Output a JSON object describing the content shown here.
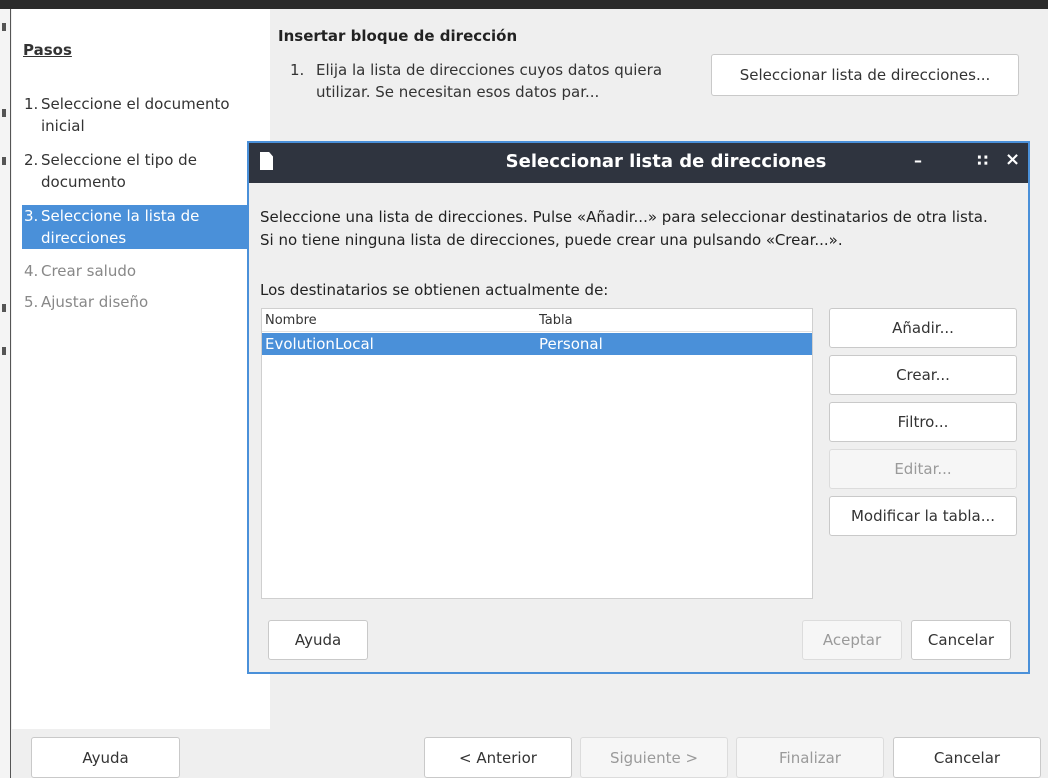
{
  "wizard": {
    "steps_title": "Pasos",
    "steps": [
      {
        "num": "1.",
        "label": "Seleccione el documento inicial"
      },
      {
        "num": "2.",
        "label": "Seleccione el tipo de documento"
      },
      {
        "num": "3.",
        "label": "Seleccione la lista de direcciones"
      },
      {
        "num": "4.",
        "label": "Crear saludo"
      },
      {
        "num": "5.",
        "label": "Ajustar diseño"
      }
    ],
    "heading": "Insertar bloque de dirección",
    "instruction_num": "1.",
    "instruction": "Elija la lista de direcciones cuyos datos quiera utilizar. Se necesitan esos datos par...",
    "select_list_button": "Seleccionar lista de direcciones...",
    "footer": {
      "help": "Ayuda",
      "back": "< Anterior",
      "next": "Siguiente >",
      "finish": "Finalizar",
      "cancel": "Cancelar"
    }
  },
  "dialog": {
    "title": "Seleccionar lista de direcciones",
    "window_buttons": {
      "minimize": "–",
      "maximize": "∷",
      "close": "×"
    },
    "description": "Seleccione una lista de direcciones. Pulse «Añadir...» para seleccionar destinatarios de otra lista. Si no tiene ninguna lista de direcciones, puede crear una pulsando «Crear...».",
    "list_label": "Los destinatarios se obtienen actualmente de:",
    "columns": [
      "Nombre",
      "Tabla"
    ],
    "rows": [
      {
        "name": "EvolutionLocal",
        "table": "Personal",
        "selected": true
      }
    ],
    "side_buttons": {
      "add": "Añadir...",
      "create": "Crear...",
      "filter": "Filtro...",
      "edit": "Editar...",
      "modify": "Modificar la tabla..."
    },
    "help": "Ayuda",
    "ok": "Aceptar",
    "cancel": "Cancelar"
  },
  "colors": {
    "accent": "#4a90d9",
    "titlebar": "#2f343f"
  }
}
